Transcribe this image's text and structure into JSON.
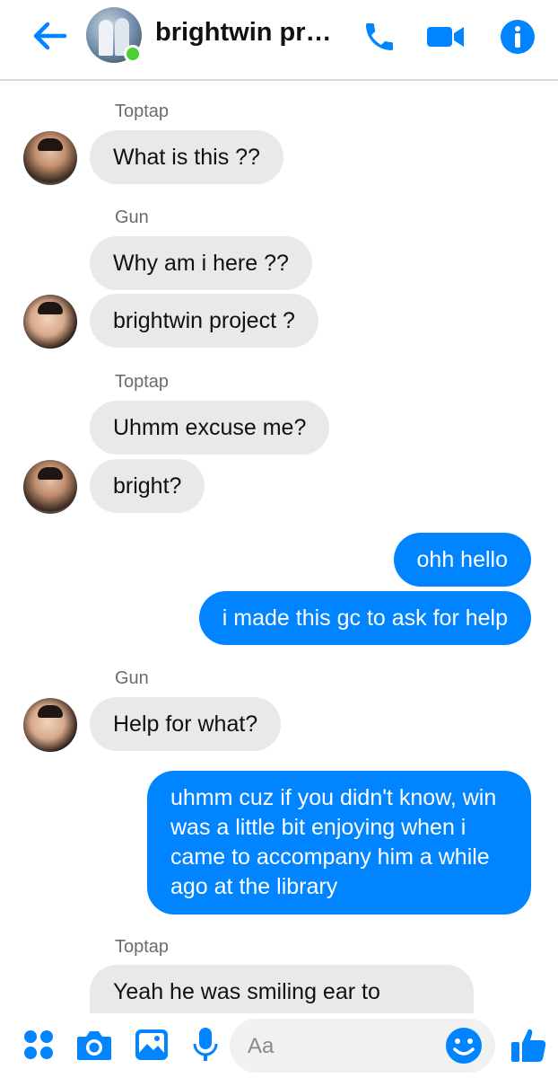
{
  "header": {
    "title": "brightwin proje...",
    "accent": "#0084ff",
    "online_color": "#4ccf30",
    "icons": [
      "back-arrow-icon",
      "phone-icon",
      "video-camera-icon",
      "info-icon"
    ]
  },
  "messages": [
    {
      "sender": "Toptap",
      "text": "What is this ??",
      "direction": "incoming"
    },
    {
      "sender": "Gun",
      "text": "Why am i here ??",
      "direction": "incoming"
    },
    {
      "sender": "Gun",
      "text": "brightwin project ?",
      "direction": "incoming"
    },
    {
      "sender": "Toptap",
      "text": "Uhmm excuse me?",
      "direction": "incoming"
    },
    {
      "sender": "Toptap",
      "text": "bright?",
      "direction": "incoming"
    },
    {
      "sender": "me",
      "text": "ohh hello",
      "direction": "outgoing"
    },
    {
      "sender": "me",
      "text": "i made this gc to ask for help",
      "direction": "outgoing"
    },
    {
      "sender": "Gun",
      "text": "Help for what?",
      "direction": "incoming"
    },
    {
      "sender": "me",
      "text": "uhmm cuz if you didn't know, win was a little bit enjoying when i came to accompany him a while ago at the library",
      "direction": "outgoing"
    },
    {
      "sender": "Toptap",
      "text": "Yeah he was smiling ear to",
      "direction": "incoming"
    }
  ],
  "sender_labels": {
    "toptap_1": "Toptap",
    "gun_1": "Gun",
    "toptap_2": "Toptap",
    "gun_2": "Gun",
    "toptap_3": "Toptap"
  },
  "composer": {
    "placeholder": "Aa",
    "icons": [
      "apps-dots-icon",
      "camera-icon",
      "image-icon",
      "microphone-icon",
      "emoji-icon",
      "thumbs-up-icon"
    ]
  },
  "colors": {
    "incoming_bubble": "#e9e9ea",
    "outgoing_bubble": "#0084ff"
  }
}
